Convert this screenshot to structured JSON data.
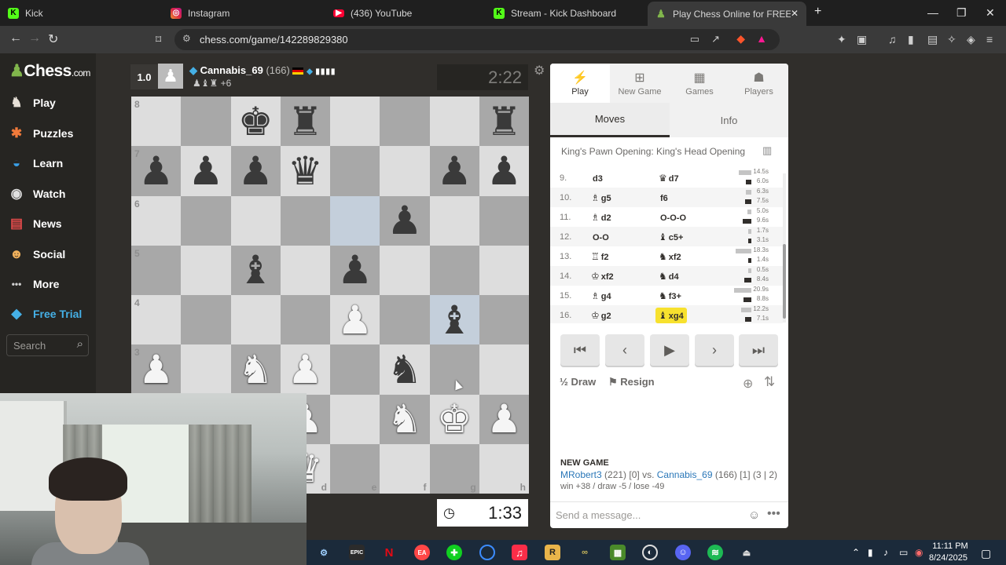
{
  "browser": {
    "tabs": [
      {
        "label": "Kick",
        "icon": "kick-icon",
        "color": "#53fc18"
      },
      {
        "label": "Instagram",
        "icon": "instagram-icon",
        "color": "#e1306c"
      },
      {
        "label": "(436) YouTube",
        "icon": "youtube-icon",
        "color": "#ff0033"
      },
      {
        "label": "Stream - Kick Dashboard",
        "icon": "kick-icon",
        "color": "#53fc18"
      },
      {
        "label": "Play Chess Online for FREE - ",
        "icon": "chess-pawn-icon",
        "color": "#81b64c"
      }
    ],
    "url": "chess.com/game/142289829380"
  },
  "sidebar": {
    "logo": "Chess",
    "logo_suffix": ".com",
    "items": [
      {
        "label": "Play",
        "icon": "play-icon"
      },
      {
        "label": "Puzzles",
        "icon": "puzzles-icon"
      },
      {
        "label": "Learn",
        "icon": "learn-icon"
      },
      {
        "label": "Watch",
        "icon": "watch-icon"
      },
      {
        "label": "News",
        "icon": "news-icon"
      },
      {
        "label": "Social",
        "icon": "social-icon"
      },
      {
        "label": "More",
        "icon": "more-icon"
      },
      {
        "label": "Free Trial",
        "icon": "diamond-icon"
      }
    ],
    "search_placeholder": "Search"
  },
  "opponent": {
    "score": "1.0",
    "name": "Cannabis_69",
    "rating": "(166)",
    "captured": "♟♝♜ +6",
    "clock": "2:22"
  },
  "player": {
    "clock": "1:33"
  },
  "board": {
    "ranks": [
      "8",
      "7",
      "6",
      "5",
      "4",
      "3"
    ],
    "files": [
      "d",
      "e",
      "f",
      "g",
      "h"
    ],
    "position": [
      [
        "",
        "",
        "bK",
        "bR",
        "",
        "",
        "",
        "bR"
      ],
      [
        "bP",
        "bP",
        "bP",
        "bQ",
        "",
        "",
        "bP",
        "bP"
      ],
      [
        "",
        "",
        "",
        "",
        "",
        "bP",
        "",
        ""
      ],
      [
        "",
        "",
        "bB",
        "",
        "bP",
        "",
        "",
        ""
      ],
      [
        "",
        "",
        "",
        "",
        "wP",
        "",
        "bB",
        ""
      ],
      [
        "wP",
        "",
        "wN",
        "wP",
        "",
        "bN",
        "",
        ""
      ],
      [
        "",
        "",
        "",
        "wP",
        "",
        "wN",
        "wK",
        "wP"
      ],
      [
        "",
        "",
        "",
        "wQ",
        "",
        "",
        "",
        ""
      ]
    ],
    "colors": {
      "light": "#dddddd",
      "dark": "#a8a8a8",
      "highlight": "#c4cfdb"
    }
  },
  "panel": {
    "tabs": [
      {
        "label": "Play",
        "icon": "lightning-icon"
      },
      {
        "label": "New Game",
        "icon": "plus-square-icon"
      },
      {
        "label": "Games",
        "icon": "games-icon"
      },
      {
        "label": "Players",
        "icon": "players-icon"
      }
    ],
    "subtabs": [
      "Moves",
      "Info"
    ],
    "opening": "King's Pawn Opening: King's Head Opening",
    "moves": [
      {
        "num": "9.",
        "white": "d3",
        "white_fig": "",
        "black": "d7",
        "black_fig": "♛",
        "wt": "14.5s",
        "bt": "6.0s"
      },
      {
        "num": "10.",
        "white": "g5",
        "white_fig": "♗",
        "black": "f6",
        "black_fig": "",
        "wt": "6.3s",
        "bt": "7.5s"
      },
      {
        "num": "11.",
        "white": "d2",
        "white_fig": "♗",
        "black": "O-O-O",
        "black_fig": "",
        "wt": "5.0s",
        "bt": "9.6s"
      },
      {
        "num": "12.",
        "white": "O-O",
        "white_fig": "",
        "black": "c5+",
        "black_fig": "♝",
        "wt": "1.7s",
        "bt": "3.1s"
      },
      {
        "num": "13.",
        "white": "f2",
        "white_fig": "♖",
        "black": "xf2",
        "black_fig": "♞",
        "wt": "18.3s",
        "bt": "1.4s"
      },
      {
        "num": "14.",
        "white": "xf2",
        "white_fig": "♔",
        "black": "d4",
        "black_fig": "♞",
        "wt": "0.5s",
        "bt": "8.4s"
      },
      {
        "num": "15.",
        "white": "g4",
        "white_fig": "♗",
        "black": "f3+",
        "black_fig": "♞",
        "wt": "20.9s",
        "bt": "8.8s"
      },
      {
        "num": "16.",
        "white": "g2",
        "white_fig": "♔",
        "black": "xg4",
        "black_fig": "♝",
        "wt": "12.2s",
        "bt": "7.1s"
      }
    ],
    "actions": {
      "draw": "Draw",
      "draw_prefix": "½",
      "resign": "Resign"
    },
    "new_game_label": "NEW GAME",
    "game": {
      "player1": "MRobert3",
      "p1_rating": "(221) [0]",
      "vs": "vs.",
      "player2": "Cannabis_69",
      "p2_rating": "(166) [1] (3 | 2)"
    },
    "record": "win +38 / draw -5 / lose -49",
    "chat_placeholder": "Send a message..."
  },
  "taskbar": {
    "time": "11:11 PM",
    "date": "8/24/2025"
  }
}
